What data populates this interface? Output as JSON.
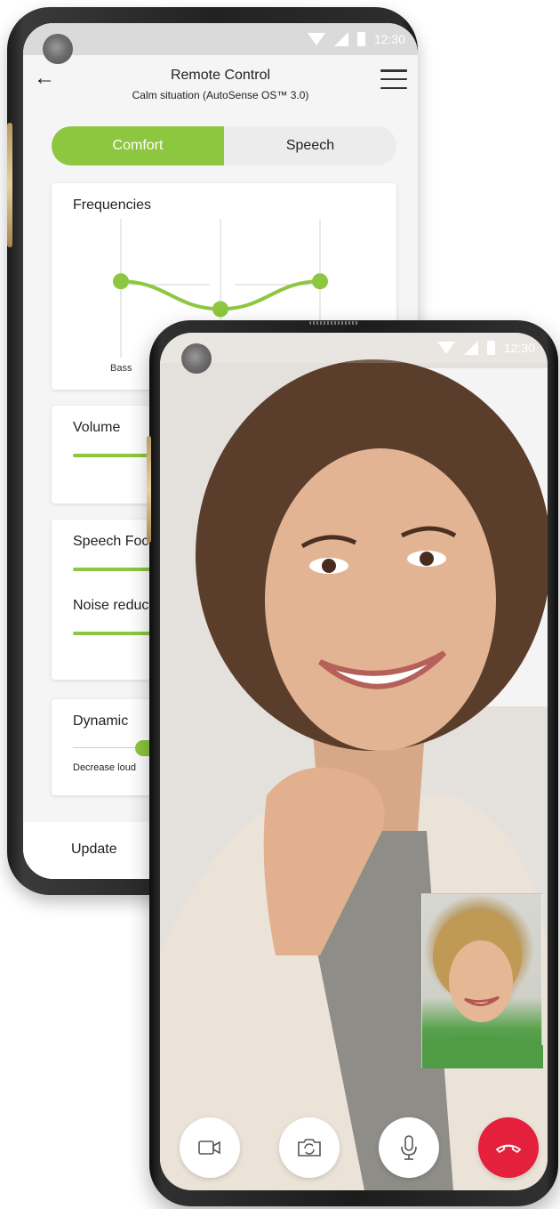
{
  "colors": {
    "accent_green": "#8dc63f",
    "end_call_red": "#e4203c"
  },
  "remote_phone": {
    "status_bar": {
      "time": "12:30",
      "icons": [
        "wifi-icon",
        "signal-icon",
        "battery-icon"
      ]
    },
    "header": {
      "back_icon": "arrow-left-icon",
      "title": "Remote Control",
      "subtitle": "Calm situation (AutoSense OS™ 3.0)",
      "menu_icon": "hamburger-menu-icon"
    },
    "tabs": [
      {
        "label": "Comfort",
        "active": true
      },
      {
        "label": "Speech",
        "active": false
      }
    ],
    "frequencies": {
      "title": "Frequencies",
      "band_labels": [
        "Bass"
      ],
      "band_levels": [
        0.55,
        0.35,
        0.55
      ]
    },
    "volume": {
      "title": "Volume",
      "level": 0.3
    },
    "speech_focus": {
      "title": "Speech Foc",
      "level": 0.3
    },
    "noise_reduction": {
      "title": "Noise reduct",
      "level": 0.3
    },
    "dynamic": {
      "title": "Dynamic",
      "left_label": "Decrease loud"
    },
    "footer": {
      "update_label": "Update"
    }
  },
  "video_phone": {
    "status_bar": {
      "time": "12:30",
      "icons": [
        "wifi-icon",
        "signal-icon",
        "battery-icon"
      ]
    },
    "controls": [
      {
        "name": "video-camera-button",
        "icon": "video-camera-icon"
      },
      {
        "name": "switch-camera-button",
        "icon": "switch-camera-icon"
      },
      {
        "name": "microphone-button",
        "icon": "microphone-icon"
      },
      {
        "name": "end-call-button",
        "icon": "hang-up-icon"
      }
    ]
  }
}
